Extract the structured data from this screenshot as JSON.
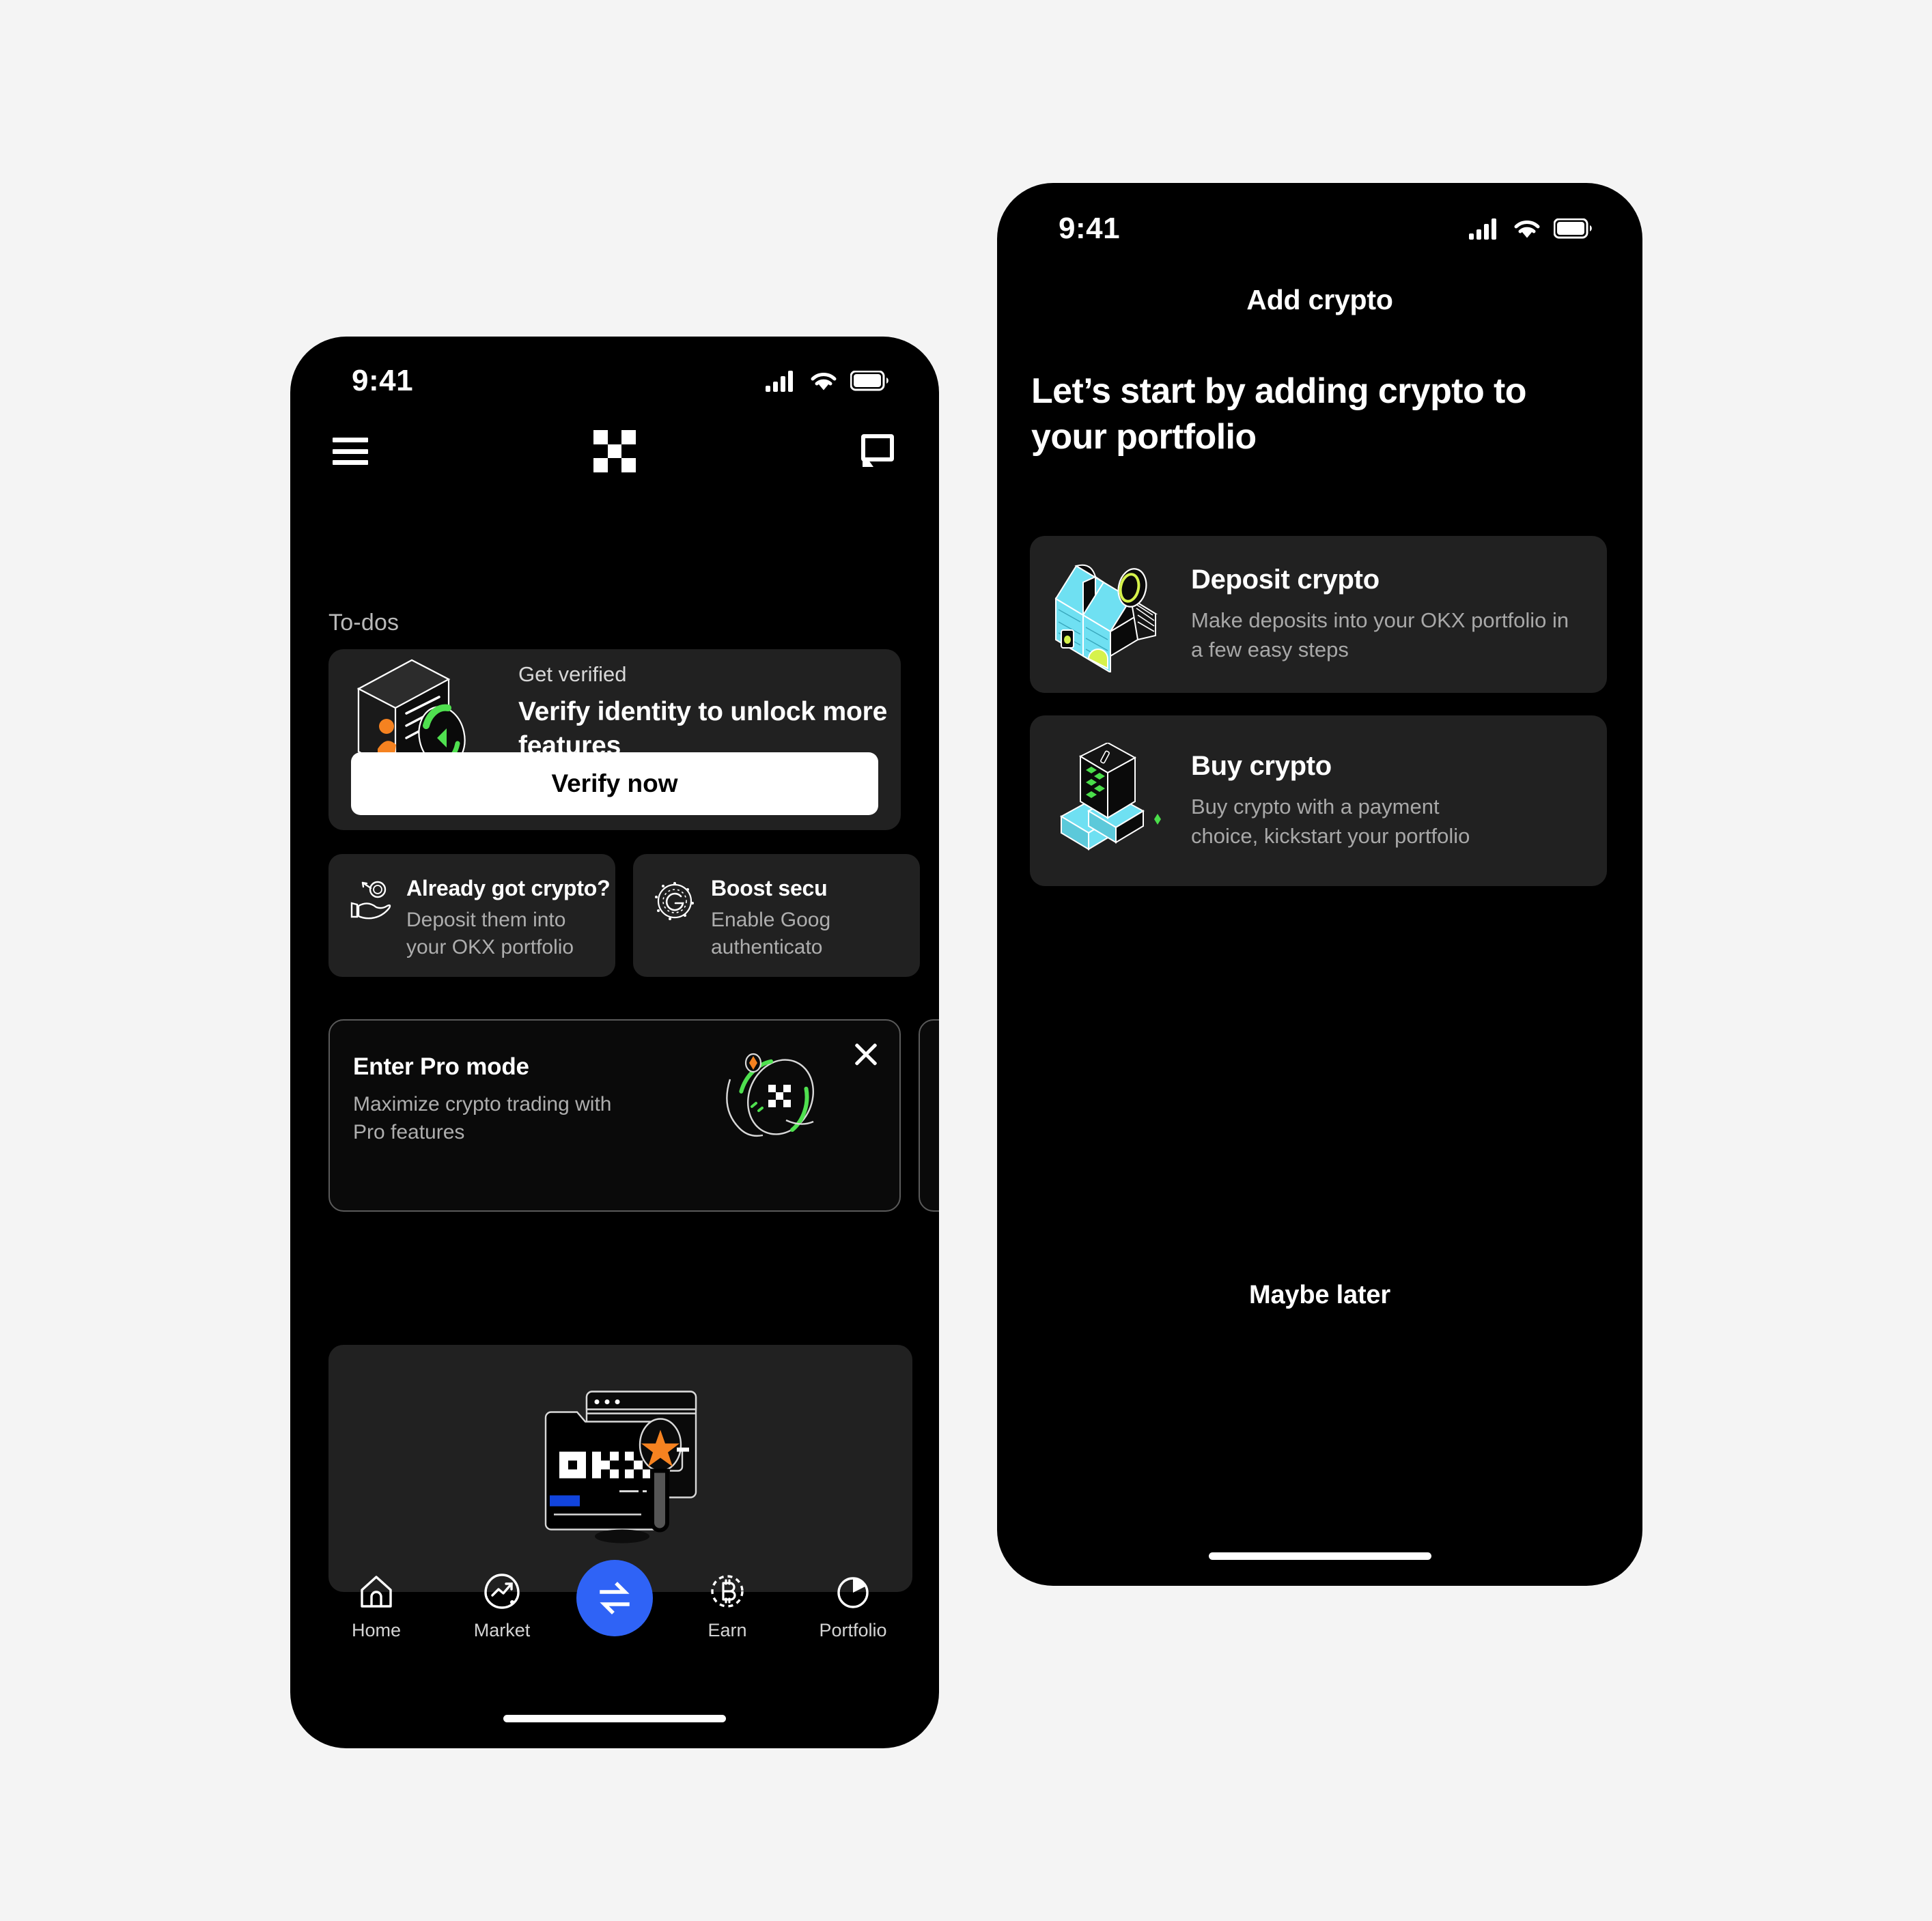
{
  "background_color": "#f4f4f4",
  "screens": {
    "home": {
      "status_bar": {
        "time": "9:41",
        "cellular": "signal-bars-icon",
        "wifi": "wifi-icon",
        "battery": "battery-icon"
      },
      "header": {
        "menu": "hamburger-menu-icon",
        "logo": "okx-logo-icon",
        "chat": "chat-bubble-icon"
      },
      "section_label": "To-dos",
      "verify_card": {
        "eyebrow": "Get verified",
        "title": "Verify identity to unlock more features",
        "button_label": "Verify now",
        "illustration": "id-card-verified-icon"
      },
      "todos": [
        {
          "title": "Already got crypto?",
          "desc": "Deposit them into your OKX portfolio",
          "icon": "hand-coin-icon"
        },
        {
          "title": "Boost secu",
          "desc_line1": "Enable Goog",
          "desc_line2": "authenticato",
          "icon": "google-authenticator-icon"
        }
      ],
      "promos": [
        {
          "title": "Enter Pro mode",
          "desc": "Maximize crypto trading with Pro features",
          "close": "close-icon",
          "illustration": "okx-orbit-icon"
        },
        {
          "title": "",
          "desc": "",
          "close": "close-icon",
          "illustration": ""
        }
      ],
      "banner": {
        "illustration": "okx-browser-star-icon"
      },
      "bottom_nav": [
        {
          "label": "Home",
          "icon": "home-icon"
        },
        {
          "label": "Market",
          "icon": "market-chart-icon"
        },
        {
          "label": "",
          "icon": "swap-arrows-icon"
        },
        {
          "label": "Earn",
          "icon": "bitcoin-dashed-icon"
        },
        {
          "label": "Portfolio",
          "icon": "pie-chart-icon"
        }
      ],
      "accent_color": "#2f63f6"
    },
    "add_crypto": {
      "status_bar": {
        "time": "9:41",
        "cellular": "signal-bars-icon",
        "wifi": "wifi-icon",
        "battery": "battery-icon"
      },
      "nav_title": "Add crypto",
      "hero_title": "Let’s start by adding crypto to your portfolio",
      "options": [
        {
          "title": "Deposit crypto",
          "desc": "Make deposits into your OKX portfolio in a few easy steps",
          "illustration": "stairs-coin-icon"
        },
        {
          "title": "Buy crypto",
          "desc": "Buy crypto with a payment choice, kickstart your portfolio",
          "illustration": "cube-stairs-icon"
        }
      ],
      "maybe_later_label": "Maybe later",
      "colors": {
        "card": "#212121",
        "cyan": "#6fe0f2",
        "lime": "#d6f24b",
        "green": "#4ade4a"
      }
    }
  }
}
